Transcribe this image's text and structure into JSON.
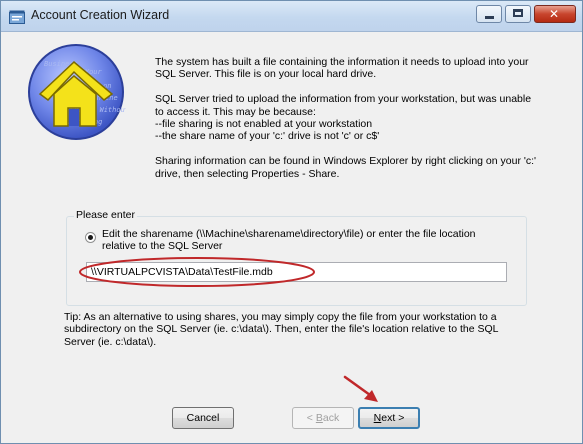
{
  "window": {
    "title": "Account Creation Wizard",
    "title_icon": "wizard-app-icon",
    "controls": [
      "minimize-icon",
      "maximize-icon",
      "close-icon"
    ]
  },
  "logo": {
    "icon": "house-logo-icon",
    "watermark_lines": [
      "Business",
      "For Your",
      "work on",
      "with the",
      "Server Without",
      "Eliminating"
    ]
  },
  "intro": {
    "p1": [
      "The system has built a file containing the information it needs to upload into your",
      "SQL Server.  This file is on your local hard drive."
    ],
    "p2": [
      "SQL Server tried to upload the information from your workstation, but was unable",
      "to access it.  This may be because:",
      " --file sharing is not enabled at your workstation",
      " --the share name of your 'c:' drive is not 'c' or c$'"
    ],
    "p3": [
      "Sharing information can be found in Windows Explorer by right clicking on your 'c:'",
      "drive, then selecting Properties - Share."
    ]
  },
  "group": {
    "label": "Please enter",
    "radio_text": [
      "Edit the sharename (\\\\Machine\\sharename\\directory\\file) or enter the file location",
      "relative to the SQL Server"
    ],
    "radio_checked": true,
    "path_value": "\\\\VIRTUALPCVISTA\\Data\\TestFile.mdb"
  },
  "tip": [
    "Tip: As an alternative to using shares, you may simply copy the file from your workstation to a",
    "subdirectory on the SQL Server (ie. c:\\data\\). Then, enter the file's location relative to the SQL",
    "Server (ie. c:\\data\\)."
  ],
  "buttons": {
    "cancel": "Cancel",
    "back_prefix": "< ",
    "back_accel": "B",
    "back_rest": "ack",
    "back_enabled": false,
    "next_accel": "N",
    "next_rest": "ext >"
  },
  "colors": {
    "annotation_red": "#c0282a",
    "focus_blue": "#3c7fb1"
  }
}
